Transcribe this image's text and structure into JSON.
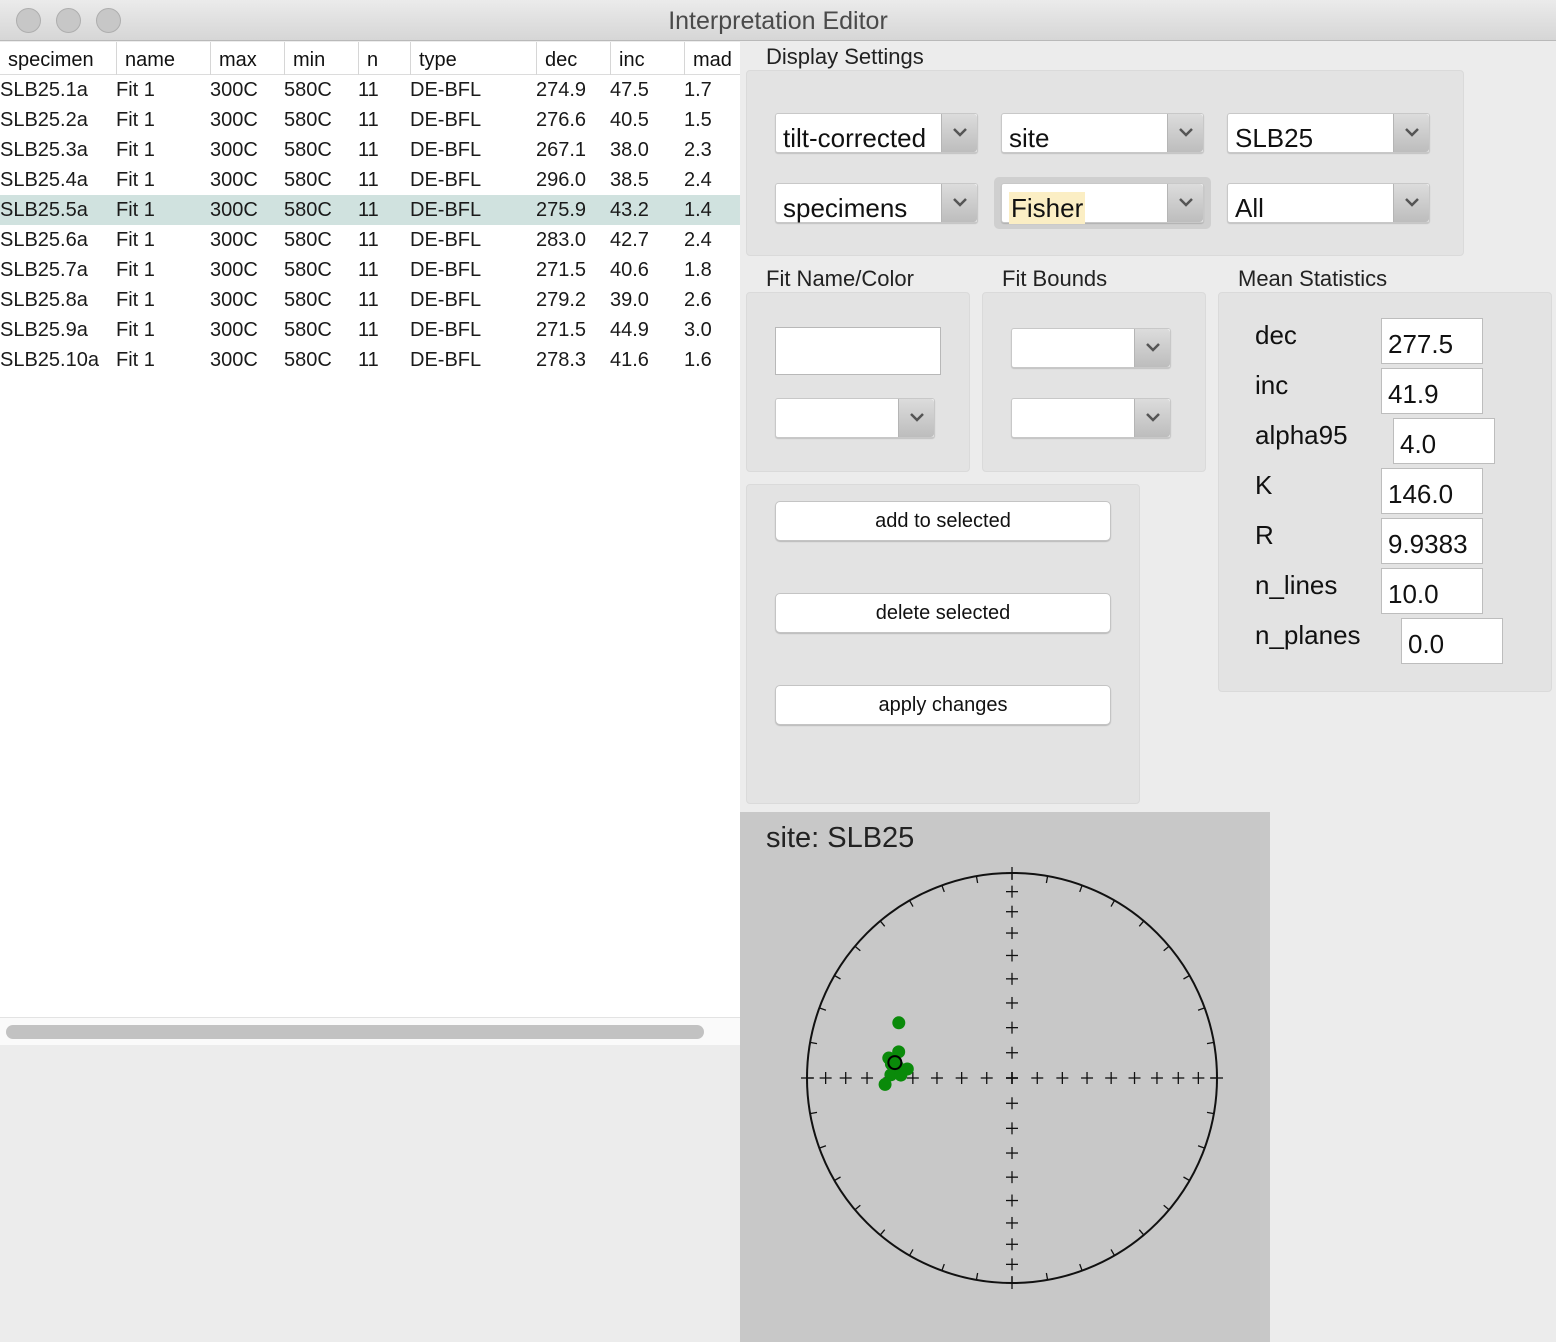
{
  "window": {
    "title": "Interpretation Editor"
  },
  "table": {
    "columns": [
      "specimen",
      "name",
      "max",
      "min",
      "n",
      "type",
      "dec",
      "inc",
      "mad"
    ],
    "rows": [
      [
        "SLB25.1a",
        "Fit 1",
        "300C",
        "580C",
        "11",
        "DE-BFL",
        "274.9",
        "47.5",
        "1.7"
      ],
      [
        "SLB25.2a",
        "Fit 1",
        "300C",
        "580C",
        "11",
        "DE-BFL",
        "276.6",
        "40.5",
        "1.5"
      ],
      [
        "SLB25.3a",
        "Fit 1",
        "300C",
        "580C",
        "11",
        "DE-BFL",
        "267.1",
        "38.0",
        "2.3"
      ],
      [
        "SLB25.4a",
        "Fit 1",
        "300C",
        "580C",
        "11",
        "DE-BFL",
        "296.0",
        "38.5",
        "2.4"
      ],
      [
        "SLB25.5a",
        "Fit 1",
        "300C",
        "580C",
        "11",
        "DE-BFL",
        "275.9",
        "43.2",
        "1.4"
      ],
      [
        "SLB25.6a",
        "Fit 1",
        "300C",
        "580C",
        "11",
        "DE-BFL",
        "283.0",
        "42.7",
        "2.4"
      ],
      [
        "SLB25.7a",
        "Fit 1",
        "300C",
        "580C",
        "11",
        "DE-BFL",
        "271.5",
        "40.6",
        "1.8"
      ],
      [
        "SLB25.8a",
        "Fit 1",
        "300C",
        "580C",
        "11",
        "DE-BFL",
        "279.2",
        "39.0",
        "2.6"
      ],
      [
        "SLB25.9a",
        "Fit 1",
        "300C",
        "580C",
        "11",
        "DE-BFL",
        "271.5",
        "44.9",
        "3.0"
      ],
      [
        "SLB25.10a",
        "Fit 1",
        "300C",
        "580C",
        "11",
        "DE-BFL",
        "278.3",
        "41.6",
        "1.6"
      ]
    ],
    "selected_row": 4,
    "selected_color": "#d0e2df"
  },
  "display_settings": {
    "label": "Display Settings",
    "coordinates": "tilt-corrected",
    "level": "site",
    "level_name": "SLB25",
    "show": "specimens",
    "mean_type": "Fisher",
    "mean_fit": "All"
  },
  "fit": {
    "name_color_label": "Fit Name/Color",
    "bounds_label": "Fit Bounds",
    "name_value": "",
    "color_value": "",
    "lower_bound": "",
    "upper_bound": ""
  },
  "buttons": {
    "add": "add to selected",
    "delete": "delete selected",
    "apply": "apply changes"
  },
  "mean_statistics": {
    "label": "Mean Statistics",
    "items": [
      {
        "label": "dec",
        "value": "277.5"
      },
      {
        "label": "inc",
        "value": "41.9"
      },
      {
        "label": "alpha95",
        "value": "4.0"
      },
      {
        "label": "K",
        "value": "146.0"
      },
      {
        "label": "R",
        "value": "9.9383"
      },
      {
        "label": "n_lines",
        "value": "10.0"
      },
      {
        "label": "n_planes",
        "value": "0.0"
      }
    ]
  },
  "plot": {
    "title": "site: SLB25",
    "projection": "equal-area",
    "point_color": "#0a8a0a",
    "points": [
      {
        "dec": 274.9,
        "inc": 47.5
      },
      {
        "dec": 276.6,
        "inc": 40.5
      },
      {
        "dec": 267.1,
        "inc": 38.0
      },
      {
        "dec": 296.0,
        "inc": 38.5
      },
      {
        "dec": 275.9,
        "inc": 43.2
      },
      {
        "dec": 283.0,
        "inc": 42.7
      },
      {
        "dec": 271.5,
        "inc": 40.6
      },
      {
        "dec": 279.2,
        "inc": 39.0
      },
      {
        "dec": 271.5,
        "inc": 44.9
      },
      {
        "dec": 278.3,
        "inc": 41.6
      }
    ],
    "mean": {
      "dec": 277.5,
      "inc": 41.9
    }
  }
}
